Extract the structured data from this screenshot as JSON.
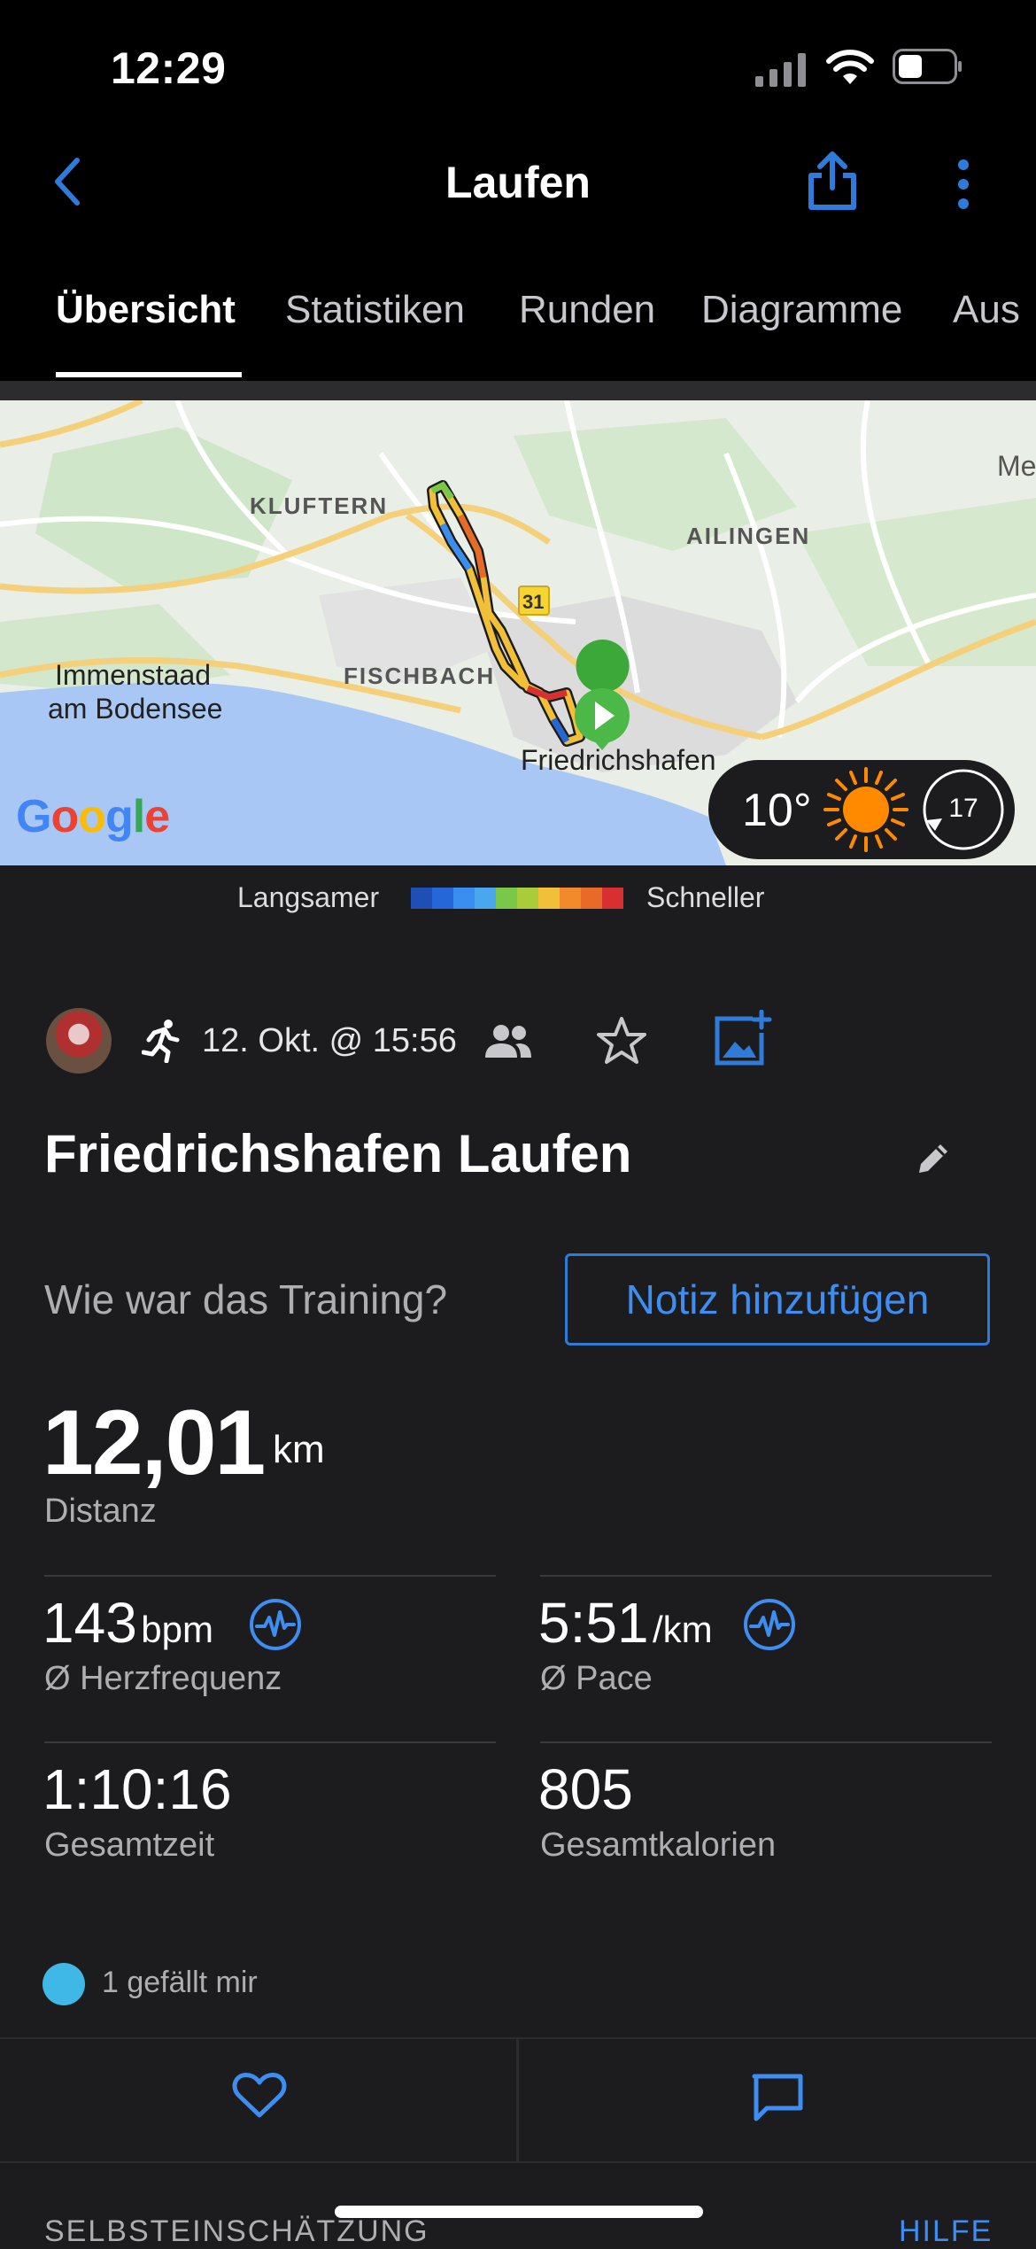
{
  "status": {
    "time": "12:29"
  },
  "header": {
    "title": "Laufen"
  },
  "tabs": [
    "Übersicht",
    "Statistiken",
    "Runden",
    "Diagramme",
    "Aus"
  ],
  "map": {
    "places": [
      "KLUFTERN",
      "AILINGEN",
      "FISCHBACH",
      "Immenstaad",
      "am Bodensee",
      "Friedrichshafen",
      "Me"
    ],
    "road_number": "31",
    "google_logo": "Google",
    "weather_temp": "10°",
    "wind_speed": "17"
  },
  "legend": {
    "slower": "Langsamer",
    "faster": "Schneller",
    "colors": [
      "#1f4fb5",
      "#2566d8",
      "#3a8ef0",
      "#4aa6ee",
      "#7ac84a",
      "#a8cc3a",
      "#f2c038",
      "#f08a2a",
      "#e86a26",
      "#d83030"
    ]
  },
  "activity": {
    "date": "12. Okt. @ 15:56",
    "title": "Friedrichshafen Laufen",
    "question": "Wie war das Training?",
    "note_button": "Notiz hinzufügen"
  },
  "stats": {
    "distance": {
      "value": "12,01",
      "unit": "km",
      "label": "Distanz"
    },
    "heart_rate": {
      "value": "143",
      "unit": "bpm",
      "label": "Ø Herzfrequenz"
    },
    "pace": {
      "value": "5:51",
      "unit": "/km",
      "label": "Ø Pace"
    },
    "total_time": {
      "value": "1:10:16",
      "label": "Gesamtzeit"
    },
    "calories": {
      "value": "805",
      "label": "Gesamtkalorien"
    }
  },
  "likes": {
    "text": "1 gefällt mir"
  },
  "footer": {
    "section_label": "SELBSTEINSCHÄTZUNG",
    "help": "HILFE"
  },
  "accent_color": "#2e7bd9"
}
